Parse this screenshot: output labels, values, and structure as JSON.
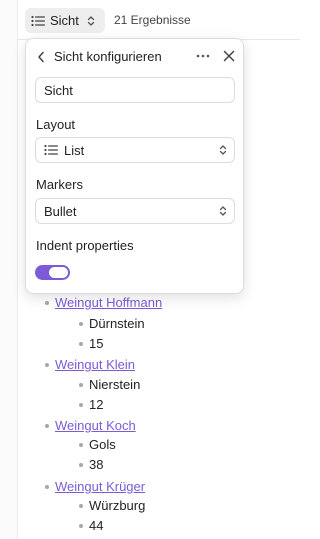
{
  "toolbar": {
    "view_label": "Sicht",
    "result_count": "21 Ergebnisse"
  },
  "popover": {
    "title": "Sicht konfigurieren",
    "name_value": "Sicht",
    "layout_label": "Layout",
    "layout_value": "List",
    "markers_label": "Markers",
    "markers_value": "Bullet",
    "indent_label": "Indent properties",
    "indent_enabled": true
  },
  "colors": {
    "accent": "#7b5cd6",
    "bullet": "#a8a8a8"
  },
  "items": [
    {
      "name": "Weingut Hoffmann",
      "place": "Dürnstein",
      "count": "15"
    },
    {
      "name": "Weingut Klein",
      "place": "Nierstein",
      "count": "12"
    },
    {
      "name": "Weingut Koch",
      "place": "Gols",
      "count": "38"
    },
    {
      "name": "Weingut Krüger",
      "place": "Würzburg",
      "count": "44"
    }
  ]
}
